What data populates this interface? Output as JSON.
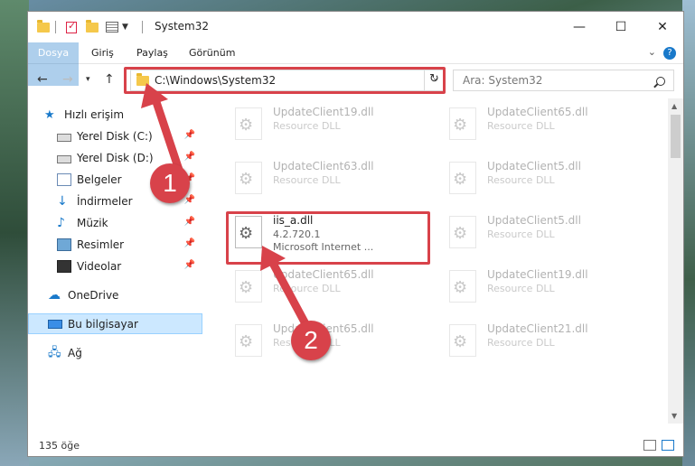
{
  "window": {
    "title": "System32"
  },
  "ribbon": {
    "tabs": [
      "Dosya",
      "Giriş",
      "Paylaş",
      "Görünüm"
    ]
  },
  "address": {
    "path": "C:\\Windows\\System32"
  },
  "search": {
    "placeholder": "Ara: System32"
  },
  "sidebar": {
    "items": [
      {
        "label": "Hızlı erişim",
        "icon": "star-icon"
      },
      {
        "label": "Yerel Disk (C:)",
        "icon": "disk-icon",
        "pinned": true
      },
      {
        "label": "Yerel Disk (D:)",
        "icon": "disk-icon",
        "pinned": true
      },
      {
        "label": "Belgeler",
        "icon": "documents-icon",
        "pinned": true
      },
      {
        "label": "İndirmeler",
        "icon": "downloads-icon",
        "pinned": true
      },
      {
        "label": "Müzik",
        "icon": "music-icon",
        "pinned": true
      },
      {
        "label": "Resimler",
        "icon": "pictures-icon",
        "pinned": true
      },
      {
        "label": "Videolar",
        "icon": "videos-icon",
        "pinned": true
      },
      {
        "label": "OneDrive",
        "icon": "onedrive-icon"
      },
      {
        "label": "Bu bilgisayar",
        "icon": "this-pc-icon",
        "selected": true
      },
      {
        "label": "Ağ",
        "icon": "network-icon"
      }
    ]
  },
  "files": [
    {
      "name": "UpdateClient19.dll",
      "desc": "Resource DLL"
    },
    {
      "name": "UpdateClient65.dll",
      "desc": "Resource DLL"
    },
    {
      "name": "UpdateClient63.dll",
      "desc": "Resource DLL"
    },
    {
      "name": "UpdateClient5.dll",
      "desc": "Resource DLL"
    },
    {
      "name": "iis_a.dll",
      "desc": "4.2.720.1",
      "desc2": "Microsoft Internet ..."
    },
    {
      "name": "UpdateClient5.dll",
      "desc": "Resource DLL"
    },
    {
      "name": "UpdateClient65.dll",
      "desc": "Resource DLL"
    },
    {
      "name": "UpdateClient19.dll",
      "desc": "Resource DLL"
    },
    {
      "name": "UpdateClient65.dll",
      "desc": "Resource DLL"
    },
    {
      "name": "UpdateClient21.dll",
      "desc": "Resource DLL"
    }
  ],
  "status": {
    "count": "135 öğe"
  },
  "callouts": {
    "one": "1",
    "two": "2"
  },
  "colors": {
    "accent": "#1979ca",
    "highlight": "#d8424a",
    "selection": "#cce8ff"
  }
}
